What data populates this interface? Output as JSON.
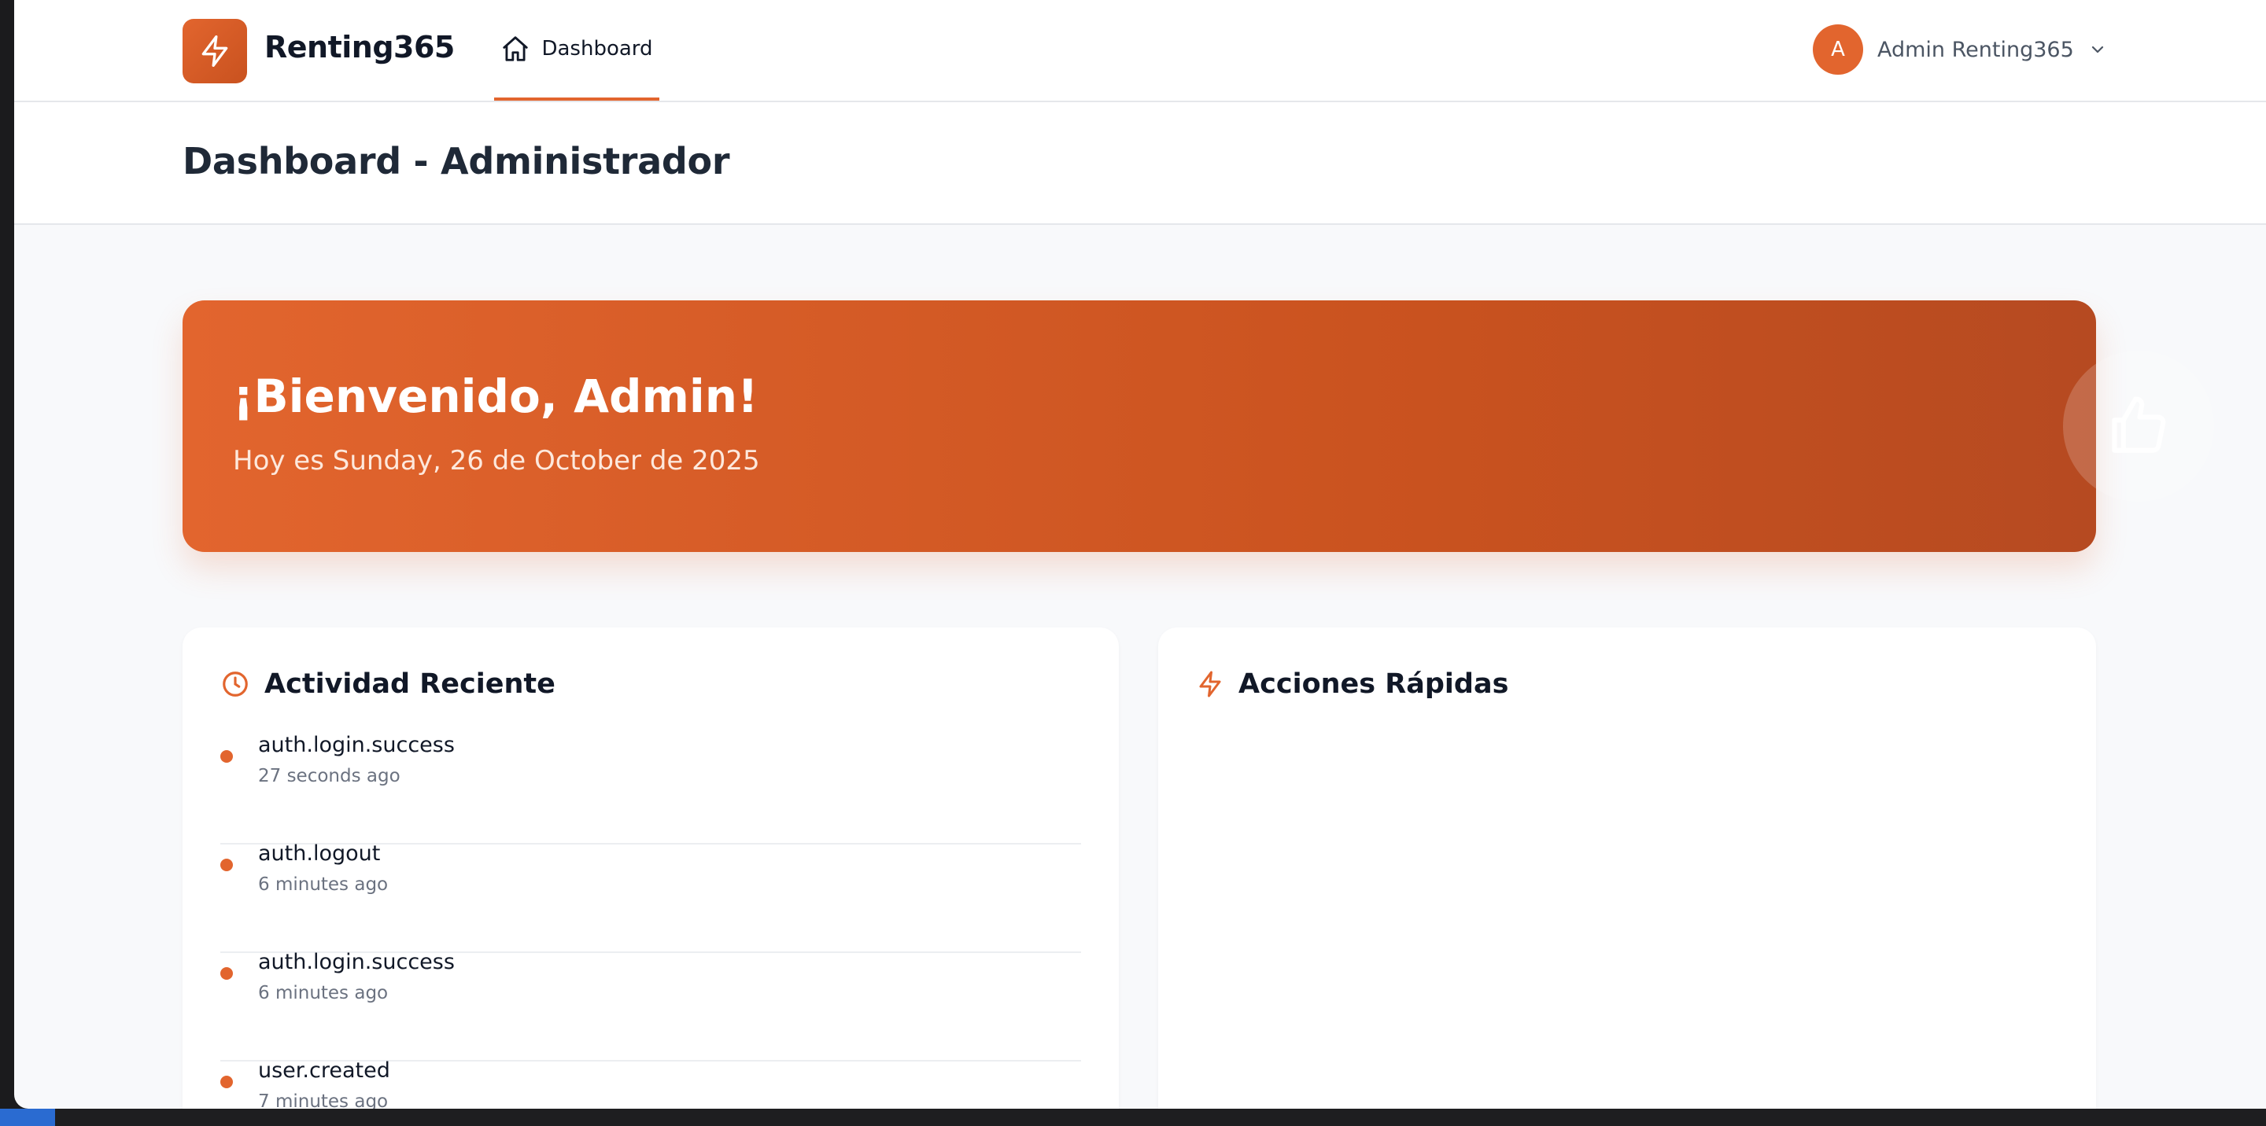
{
  "app": {
    "brand": "Renting365",
    "brand_icon": "bolt-icon",
    "accent_color": "#e2652e"
  },
  "nav": {
    "dashboard_label": "Dashboard",
    "dashboard_icon": "home-icon"
  },
  "user": {
    "avatar_initial": "A",
    "name": "Admin Renting365"
  },
  "page": {
    "title": "Dashboard - Administrador"
  },
  "welcome": {
    "title": "¡Bienvenido, Admin!",
    "subtitle": "Hoy es Sunday, 26 de October de 2025",
    "icon": "thumbs-up-icon"
  },
  "activity": {
    "title": "Actividad Reciente",
    "icon": "clock-icon",
    "items": [
      {
        "name": "auth.login.success",
        "time": "27 seconds ago"
      },
      {
        "name": "auth.logout",
        "time": "6 minutes ago"
      },
      {
        "name": "auth.login.success",
        "time": "6 minutes ago"
      },
      {
        "name": "user.created",
        "time": "7 minutes ago"
      }
    ]
  },
  "quick_actions": {
    "title": "Acciones Rápidas",
    "icon": "bolt-icon"
  }
}
